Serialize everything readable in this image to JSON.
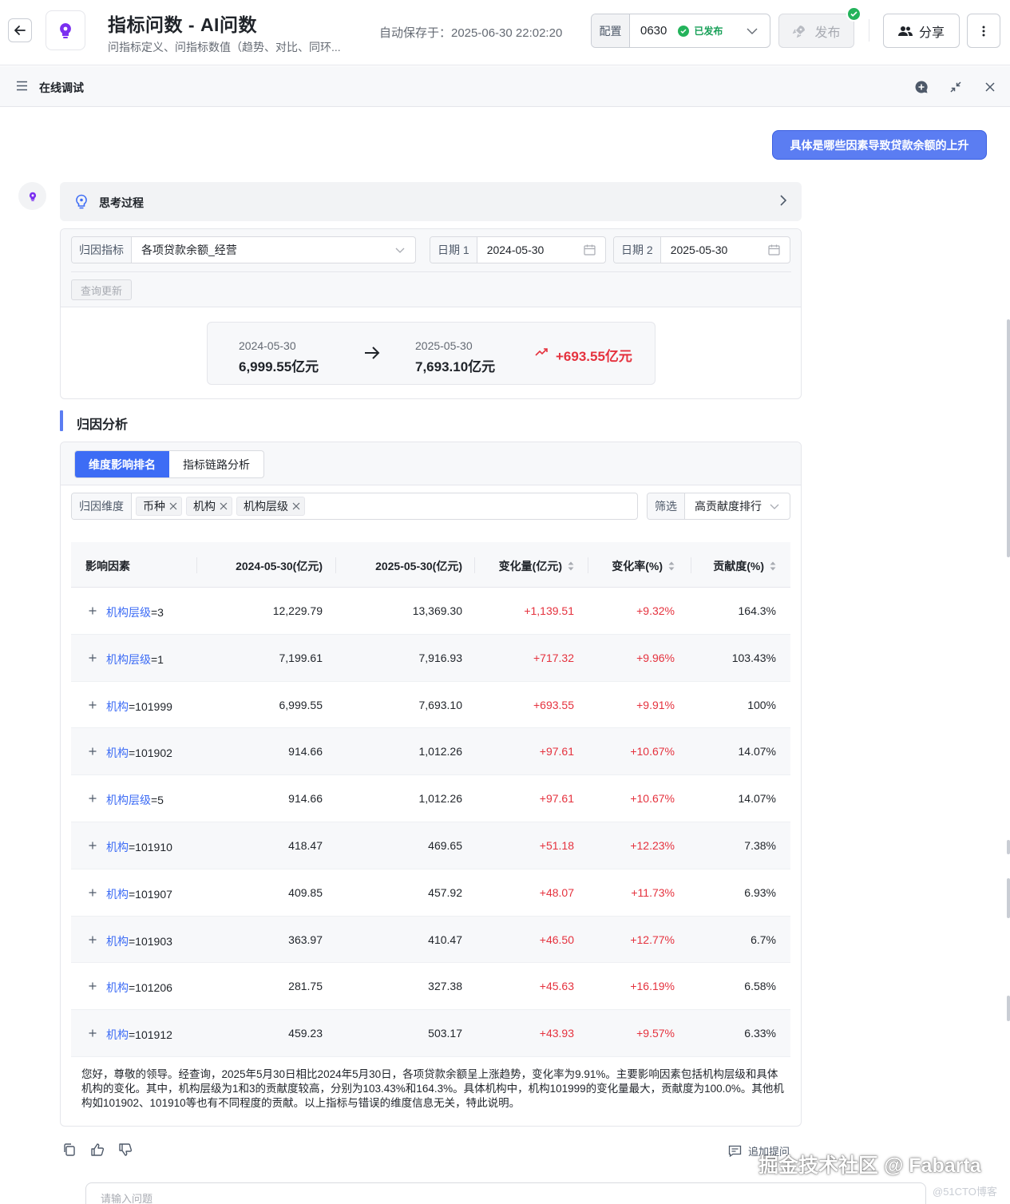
{
  "header": {
    "app_title": "指标问数 - AI问数",
    "app_subtitle": "问指标定义、问指标数值（趋势、对比、同环...",
    "autosave": "自动保存于：2025-06-30 22:02:20",
    "config_label": "配置",
    "config_version": "0630",
    "config_status": "已发布",
    "publish_label": "发布",
    "share_label": "分享"
  },
  "panel": {
    "title": "在线调试"
  },
  "chat": {
    "user_question": "具体是哪些因素导致贷款余额的上升",
    "thinking_title": "思考过程",
    "query": {
      "metric_label": "归因指标",
      "metric_value": "各项贷款余额_经营",
      "date1_label": "日期 1",
      "date1_value": "2024-05-30",
      "date2_label": "日期 2",
      "date2_value": "2025-05-30",
      "refresh_button": "查询更新"
    },
    "comparison": {
      "from_date": "2024-05-30",
      "from_value": "6,999.55亿元",
      "to_date": "2025-05-30",
      "to_value": "7,693.10亿元",
      "delta": "+693.55亿元"
    },
    "analysis": {
      "section_title": "归因分析",
      "tabs": [
        "维度影响排名",
        "指标链路分析"
      ],
      "dimension_label": "归因维度",
      "dimension_tags": [
        "币种",
        "机构",
        "机构层级"
      ],
      "filter_label": "筛选",
      "filter_value": "高贡献度排行",
      "columns": [
        "影响因素",
        "2024-05-30(亿元)",
        "2025-05-30(亿元)",
        "变化量(亿元)",
        "变化率(%)",
        "贡献度(%)"
      ],
      "rows": [
        {
          "key": "机构层级",
          "val": "=3",
          "v1": "12,229.79",
          "v2": "13,369.30",
          "delta": "+1,139.51",
          "rate": "+9.32%",
          "contrib": "164.3%"
        },
        {
          "key": "机构层级",
          "val": "=1",
          "v1": "7,199.61",
          "v2": "7,916.93",
          "delta": "+717.32",
          "rate": "+9.96%",
          "contrib": "103.43%"
        },
        {
          "key": "机构",
          "val": "=101999",
          "v1": "6,999.55",
          "v2": "7,693.10",
          "delta": "+693.55",
          "rate": "+9.91%",
          "contrib": "100%"
        },
        {
          "key": "机构",
          "val": "=101902",
          "v1": "914.66",
          "v2": "1,012.26",
          "delta": "+97.61",
          "rate": "+10.67%",
          "contrib": "14.07%"
        },
        {
          "key": "机构层级",
          "val": "=5",
          "v1": "914.66",
          "v2": "1,012.26",
          "delta": "+97.61",
          "rate": "+10.67%",
          "contrib": "14.07%"
        },
        {
          "key": "机构",
          "val": "=101910",
          "v1": "418.47",
          "v2": "469.65",
          "delta": "+51.18",
          "rate": "+12.23%",
          "contrib": "7.38%"
        },
        {
          "key": "机构",
          "val": "=101907",
          "v1": "409.85",
          "v2": "457.92",
          "delta": "+48.07",
          "rate": "+11.73%",
          "contrib": "6.93%"
        },
        {
          "key": "机构",
          "val": "=101903",
          "v1": "363.97",
          "v2": "410.47",
          "delta": "+46.50",
          "rate": "+12.77%",
          "contrib": "6.7%"
        },
        {
          "key": "机构",
          "val": "=101206",
          "v1": "281.75",
          "v2": "327.38",
          "delta": "+45.63",
          "rate": "+16.19%",
          "contrib": "6.58%"
        },
        {
          "key": "机构",
          "val": "=101912",
          "v1": "459.23",
          "v2": "503.17",
          "delta": "+43.93",
          "rate": "+9.57%",
          "contrib": "6.33%"
        }
      ],
      "summary": "您好，尊敬的领导。经查询，2025年5月30日相比2024年5月30日，各项贷款余额呈上涨趋势，变化率为9.91%。主要影响因素包括机构层级和具体机构的变化。其中，机构层级为1和3的贡献度较高，分别为103.43%和164.3%。具体机构中，机构101999的变化量最大，贡献度为100.0%。其他机构如101902、101910等也有不同程度的贡献。以上指标与错误的维度信息无关，特此说明。"
    },
    "followup_label": "追加提问",
    "input_placeholder": "请输入问题"
  },
  "watermark": {
    "main": "掘金技术社区 @ Fabarta",
    "sub": "@51CTO博客"
  },
  "colors": {
    "accent": "#3d6cf5",
    "user_bubble": "#5b7df2",
    "positive": "#e5323e",
    "success": "#23b35b"
  }
}
